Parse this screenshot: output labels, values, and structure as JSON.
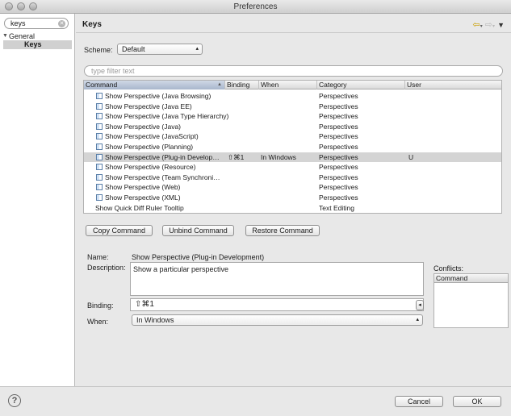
{
  "window": {
    "title": "Preferences"
  },
  "sidebar": {
    "search_value": "keys",
    "tree": {
      "group": "General",
      "selected": "Keys"
    }
  },
  "page": {
    "title": "Keys",
    "scheme_label": "Scheme:",
    "scheme_value": "Default",
    "filter_placeholder": "type filter text"
  },
  "table": {
    "columns": [
      "Command",
      "Binding",
      "When",
      "Category",
      "User"
    ],
    "rows": [
      {
        "command": "Show Perspective (Java Browsing)",
        "binding": "",
        "when": "",
        "category": "Perspectives",
        "user": "",
        "icon": true
      },
      {
        "command": "Show Perspective (Java EE)",
        "binding": "",
        "when": "",
        "category": "Perspectives",
        "user": "",
        "icon": true
      },
      {
        "command": "Show Perspective (Java Type Hierarchy)",
        "binding": "",
        "when": "",
        "category": "Perspectives",
        "user": "",
        "icon": true
      },
      {
        "command": "Show Perspective (Java)",
        "binding": "",
        "when": "",
        "category": "Perspectives",
        "user": "",
        "icon": true
      },
      {
        "command": "Show Perspective (JavaScript)",
        "binding": "",
        "when": "",
        "category": "Perspectives",
        "user": "",
        "icon": true
      },
      {
        "command": "Show Perspective (Planning)",
        "binding": "",
        "when": "",
        "category": "Perspectives",
        "user": "",
        "icon": true
      },
      {
        "command": "Show Perspective (Plug-in Develop…",
        "binding": "⇧⌘1",
        "when": "In Windows",
        "category": "Perspectives",
        "user": "U",
        "icon": true,
        "selected": true
      },
      {
        "command": "Show Perspective (Resource)",
        "binding": "",
        "when": "",
        "category": "Perspectives",
        "user": "",
        "icon": true
      },
      {
        "command": "Show Perspective (Team Synchroni…",
        "binding": "",
        "when": "",
        "category": "Perspectives",
        "user": "",
        "icon": true
      },
      {
        "command": "Show Perspective (Web)",
        "binding": "",
        "when": "",
        "category": "Perspectives",
        "user": "",
        "icon": true
      },
      {
        "command": "Show Perspective (XML)",
        "binding": "",
        "when": "",
        "category": "Perspectives",
        "user": "",
        "icon": true
      },
      {
        "command": "Show Quick Diff Ruler Tooltip",
        "binding": "",
        "when": "",
        "category": "Text Editing",
        "user": "",
        "icon": false
      }
    ]
  },
  "actions": {
    "copy": "Copy Command",
    "unbind": "Unbind Command",
    "restore": "Restore Command"
  },
  "details": {
    "name_label": "Name:",
    "name_value": "Show Perspective (Plug-in Development)",
    "description_label": "Description:",
    "description_value": "Show a particular perspective",
    "binding_label": "Binding:",
    "binding_value": "⇧⌘1",
    "when_label": "When:",
    "when_value": "In Windows",
    "conflicts_label": "Conflicts:",
    "conflicts_header": "Command"
  },
  "footer": {
    "help": "?",
    "cancel": "Cancel",
    "ok": "OK"
  }
}
